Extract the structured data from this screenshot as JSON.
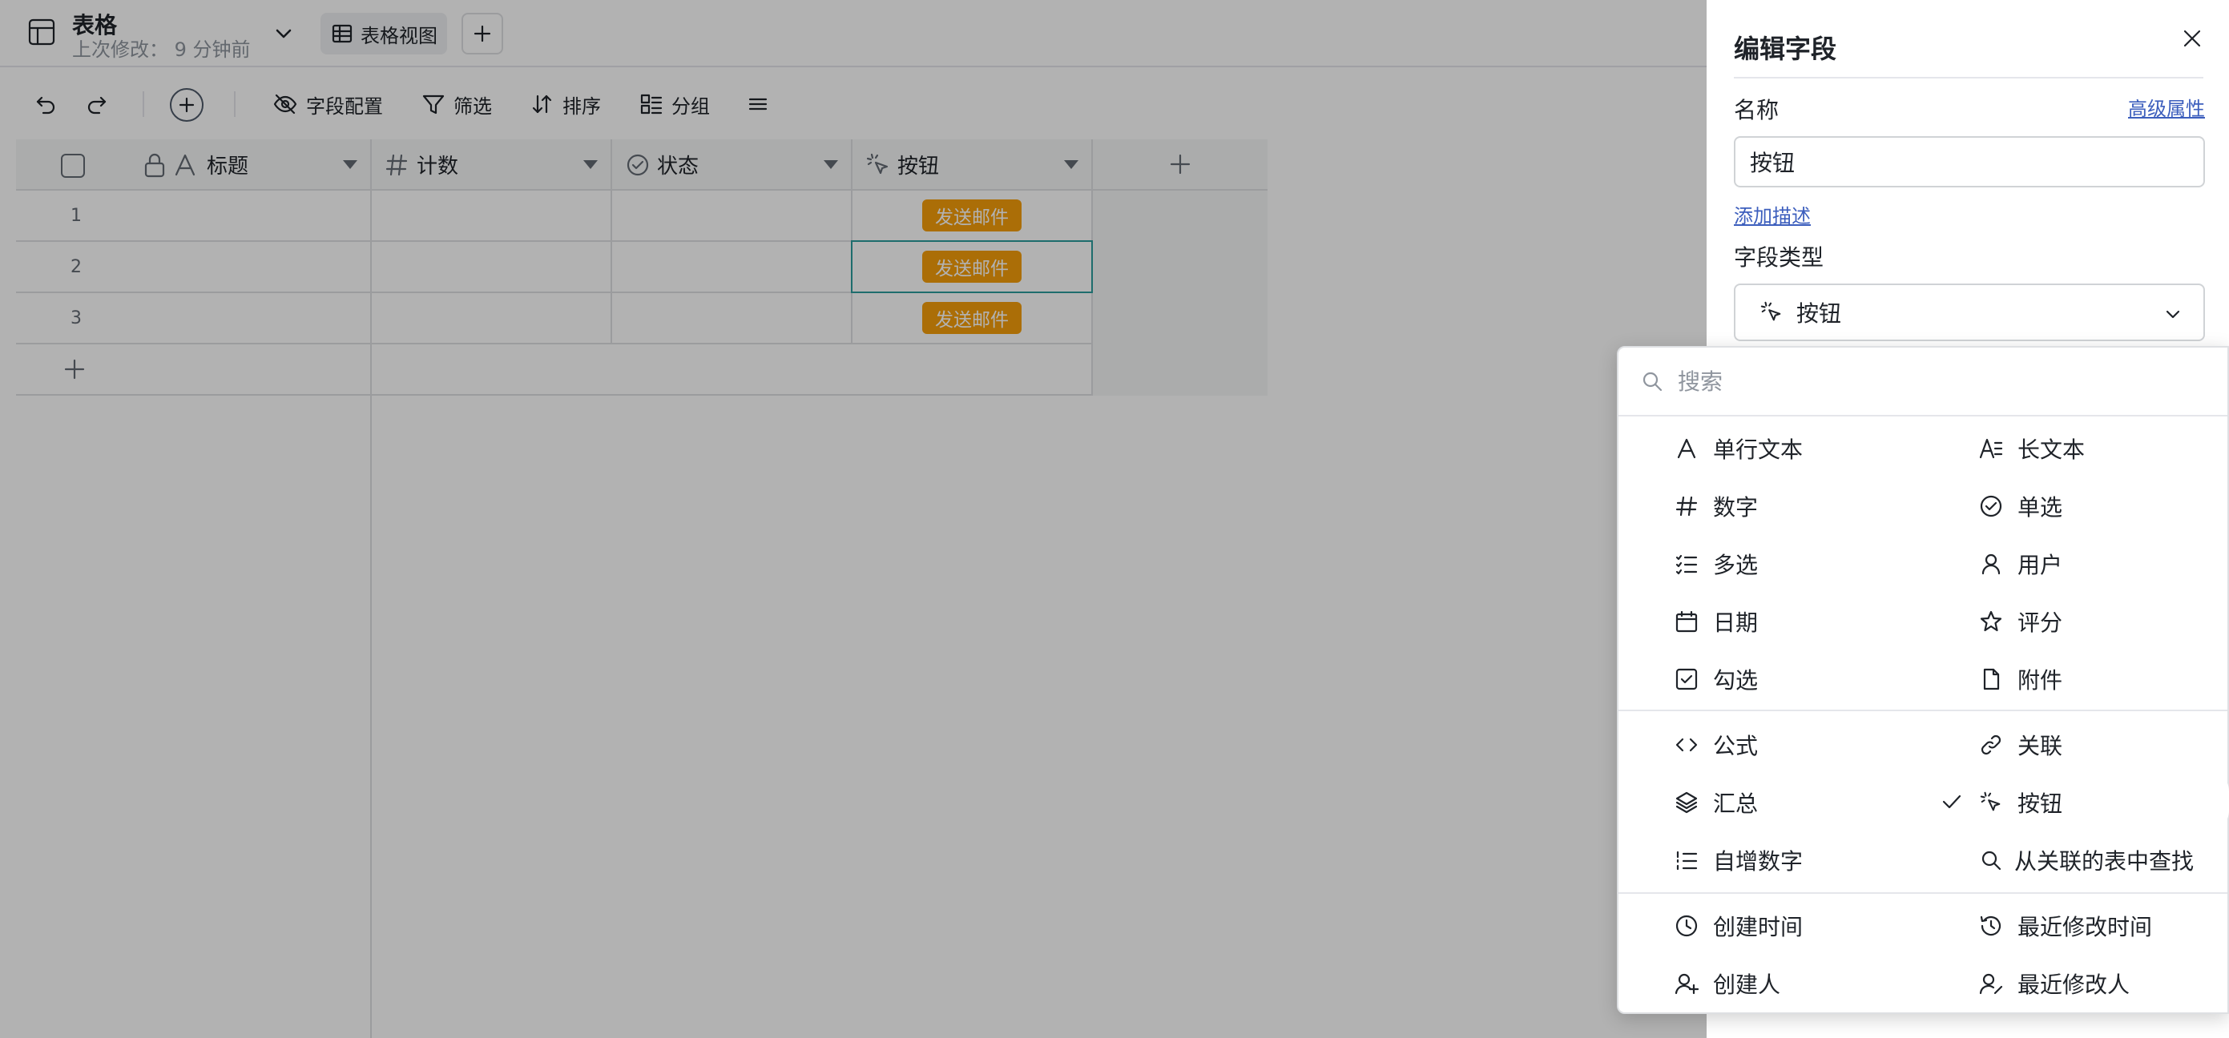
{
  "header": {
    "title": "表格",
    "last_modified": "上次修改： 9 分钟前",
    "view_tab": "表格视图"
  },
  "toolbar": {
    "field_config": "字段配置",
    "filter": "筛选",
    "sort": "排序",
    "group": "分组"
  },
  "grid": {
    "columns": [
      "标题",
      "计数",
      "状态",
      "按钮"
    ],
    "rows": [
      {
        "num": "1",
        "button": "发送邮件"
      },
      {
        "num": "2",
        "button": "发送邮件"
      },
      {
        "num": "3",
        "button": "发送邮件"
      }
    ],
    "selected_row": 2
  },
  "panel": {
    "title": "编辑字段",
    "name_label": "名称",
    "advanced_link": "高级属性",
    "name_value": "按钮",
    "add_description": "添加描述",
    "field_type_label": "字段类型",
    "field_type_value": "按钮"
  },
  "dropdown": {
    "search_placeholder": "搜索",
    "selected": "按钮",
    "options": {
      "single_line_text": "单行文本",
      "long_text": "长文本",
      "number": "数字",
      "single_select": "单选",
      "multi_select": "多选",
      "user": "用户",
      "date": "日期",
      "rating": "评分",
      "checkbox": "勾选",
      "attachment": "附件",
      "formula": "公式",
      "link": "关联",
      "rollup": "汇总",
      "button": "按钮",
      "auto_number": "自增数字",
      "lookup": "从关联的表中查找",
      "created_time": "创建时间",
      "last_modified_time": "最近修改时间",
      "created_by": "创建人",
      "last_modified_by": "最近修改人"
    }
  },
  "colors": {
    "button_fill": "#f59e0b",
    "link": "#3c5ebd",
    "selection_border": "#2c9c9c"
  }
}
